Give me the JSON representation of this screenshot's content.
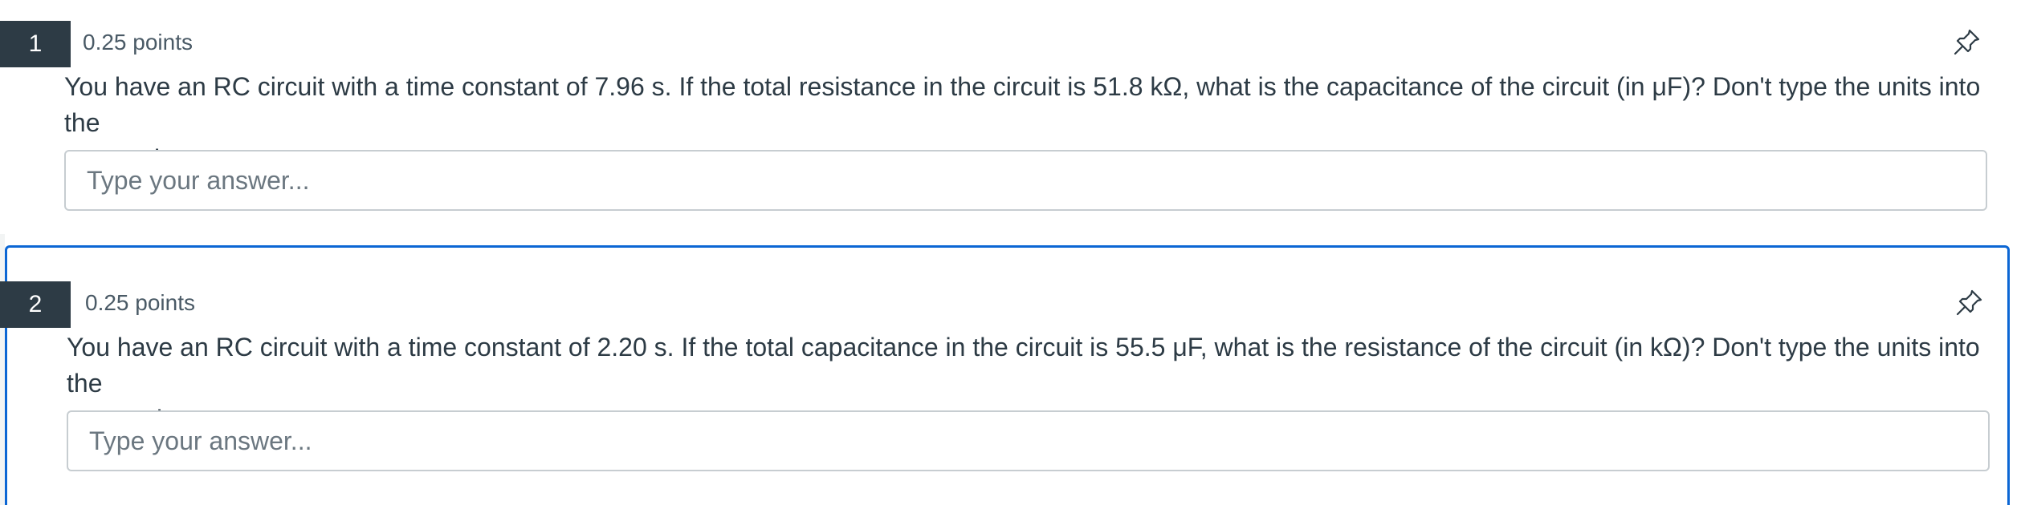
{
  "questions": [
    {
      "number": "1",
      "points": "0.25 points",
      "text_line1": "You have an RC circuit with a time constant of 7.96 s. If the total resistance in the circuit is 51.8 kΩ, what is the capacitance of the circuit (in μF)? Don't type the units into the",
      "text_line2": "answer box.",
      "answer_placeholder": "Type your answer...",
      "answer_value": ""
    },
    {
      "number": "2",
      "points": "0.25 points",
      "text_line1": "You have an RC circuit with a time constant of 2.20 s. If the total capacitance in the circuit is 55.5 μF, what is the resistance of the circuit (in kΩ)? Don't type the units into the",
      "text_line2": "answer box.",
      "answer_placeholder": "Type your answer...",
      "answer_value": ""
    }
  ],
  "icons": {
    "pin": "pin-icon"
  },
  "colors": {
    "number_badge_bg": "#2d3b45",
    "focus_border": "#0b66d4",
    "text": "#2d3b45"
  }
}
